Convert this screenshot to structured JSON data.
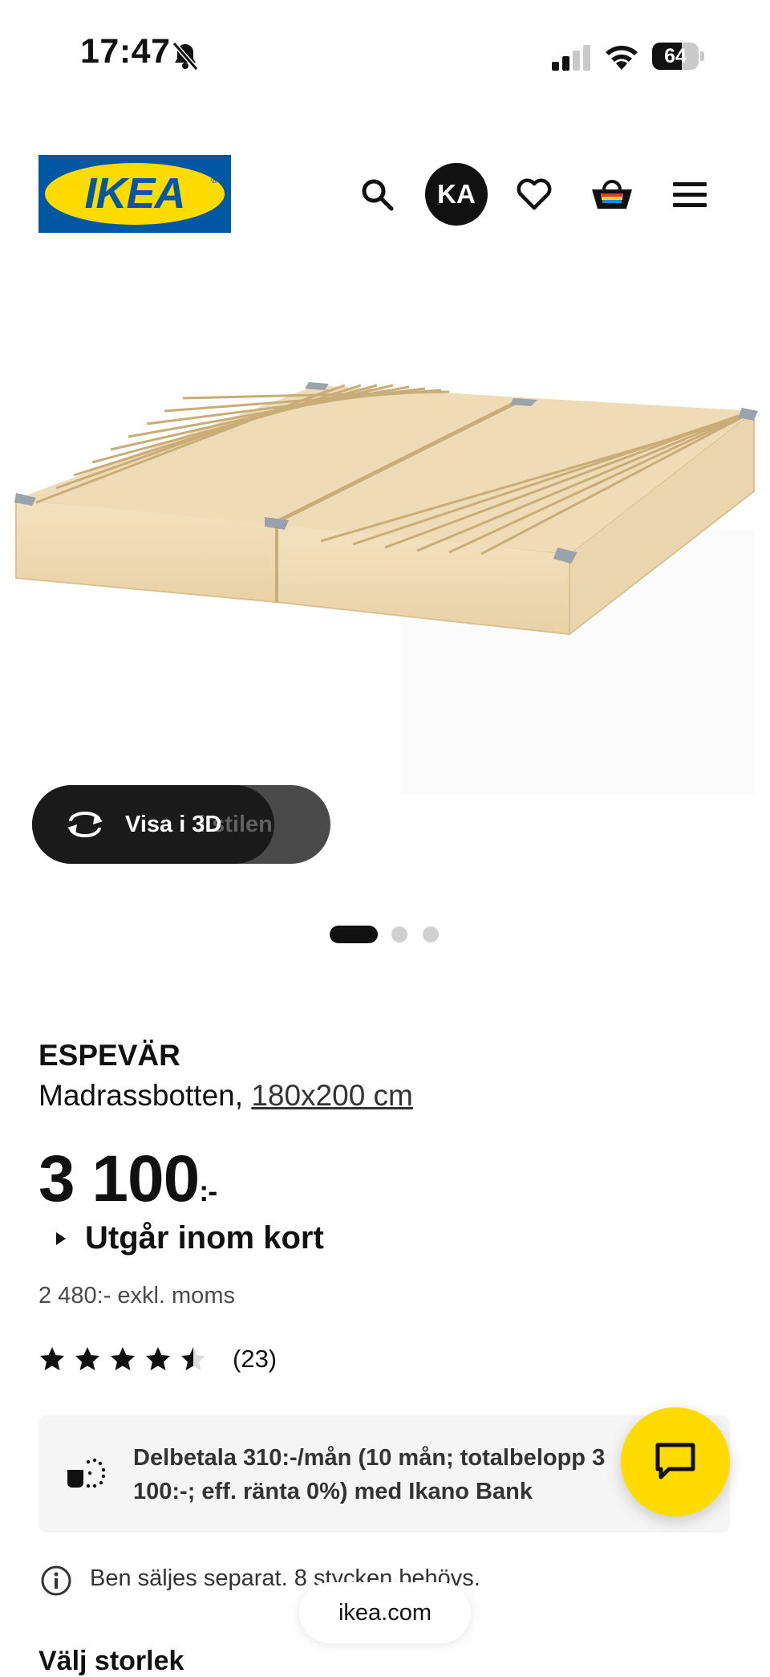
{
  "status_bar": {
    "time": "17:47",
    "battery_level": "64",
    "battery_fraction": 0.64,
    "icons": [
      "bell-slash-icon",
      "cellular-signal-icon",
      "wifi-icon",
      "battery-icon"
    ]
  },
  "header": {
    "logo_text": "IKEA",
    "logo_colors": {
      "blue": "#0058a3",
      "yellow": "#ffdb00"
    },
    "avatar_initials": "KA",
    "icons": [
      "search-icon",
      "heart-icon",
      "cart-icon",
      "menu-icon"
    ]
  },
  "gallery": {
    "view_3d_label": "Visa i 3D",
    "ghost_label": "i stilen",
    "dots_total": 3,
    "active_index": 0
  },
  "product": {
    "name": "ESPEVÄR",
    "description": "Madrassbotten, ",
    "size_link": "180x200 cm",
    "price_main": "3 100",
    "price_suffix": ":-",
    "availability": "Utgår inom kort",
    "excl_vat": "2 480:- exkl. moms",
    "rating_value": 4.5,
    "rating_max": 5,
    "rating_count": "(23)"
  },
  "finance": {
    "text": "Delbetala 310:-/mån (10 mån; totalbelopp 3 100:-; eff. ränta 0%) med Ikano Bank"
  },
  "note": {
    "text": "Ben säljes separat. 8 stycken behövs."
  },
  "choose_size": {
    "heading": "Välj storlek"
  },
  "browser": {
    "url": "ikea.com"
  },
  "colors": {
    "accent_yellow": "#ffdb00",
    "text_dark": "#111111",
    "finance_bg": "#f5f5f5"
  }
}
